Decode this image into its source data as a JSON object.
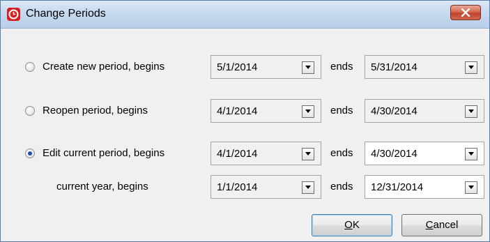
{
  "window": {
    "title": "Change Periods"
  },
  "icons": {
    "app": "clock-icon",
    "close": "close-icon",
    "dropdown": "chevron-down-icon"
  },
  "colors": {
    "app_icon": "#d81e1e",
    "close_button": "#c0412a",
    "title_bar": "#c6d9ef",
    "radio_dot": "#1f4fa8"
  },
  "rows": [
    {
      "label": "Create new period, begins",
      "radio": true,
      "checked": false,
      "begin": "5/1/2014",
      "ends_label": "ends",
      "end": "5/31/2014"
    },
    {
      "label": "Reopen period, begins",
      "radio": true,
      "checked": false,
      "begin": "4/1/2014",
      "ends_label": "ends",
      "end": "4/30/2014"
    },
    {
      "label": "Edit current period, begins",
      "radio": true,
      "checked": true,
      "begin": "4/1/2014",
      "ends_label": "ends",
      "end": "4/30/2014"
    },
    {
      "label": "current year, begins",
      "radio": false,
      "checked": false,
      "begin": "1/1/2014",
      "ends_label": "ends",
      "end": "12/31/2014"
    }
  ],
  "buttons": {
    "ok": {
      "mnemonic": "O",
      "rest": "K"
    },
    "cancel": {
      "mnemonic": "C",
      "rest": "ancel"
    }
  }
}
